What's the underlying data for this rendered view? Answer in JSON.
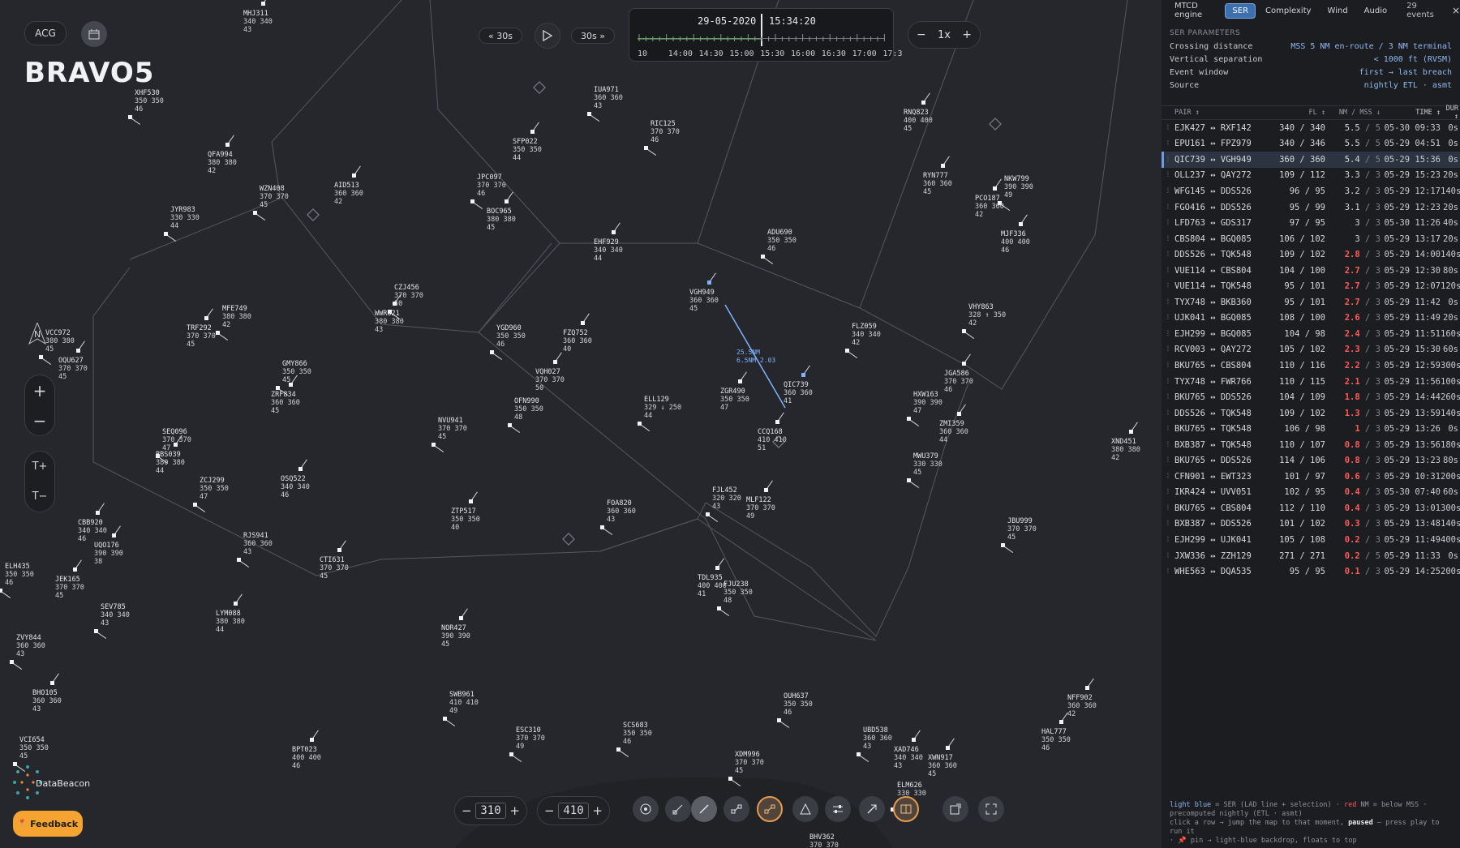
{
  "map": {
    "title": "BRAVO5",
    "acg_label": "ACG",
    "calendar_icon": "calendar-icon",
    "rewind_label": "« 30s",
    "forward_label": "30s »",
    "play_icon": "play-icon",
    "timeline": {
      "date": "29-05-2020",
      "time": "15:34:20",
      "labels": [
        "10",
        "14:00",
        "14:30",
        "15:00",
        "15:30",
        "16:00",
        "16:30",
        "17:00",
        "17:3"
      ]
    },
    "speed": {
      "minus": "−",
      "value": "1x",
      "plus": "+"
    },
    "zoom": {
      "in": "+",
      "out": "−"
    },
    "text_size": {
      "larger": "T+",
      "smaller": "T−"
    },
    "north_label": "N",
    "fl_lower": "310",
    "fl_upper": "410",
    "feedback_label": "Feedback",
    "logo_label": "DataBeacon",
    "sep_line": {
      "label1": "25.5NM",
      "label2": "6.5NM 2.03"
    }
  },
  "aircraft": [
    [
      "MHJ311",
      "340 340",
      "43",
      300,
      12,
      1
    ],
    [
      "XHF530",
      "350 350",
      "46",
      166,
      110,
      0
    ],
    [
      "QFA994",
      "380 380",
      "42",
      256,
      186,
      1
    ],
    [
      "WZN408",
      "370 370",
      "45",
      320,
      228,
      0
    ],
    [
      "AID513",
      "360 360",
      "42",
      412,
      224,
      1
    ],
    [
      "JYR983",
      "330 330",
      "44",
      210,
      254,
      0
    ],
    [
      "SFP022",
      "350 350",
      "44",
      632,
      170,
      1
    ],
    [
      "JPC097",
      "370 370",
      "46",
      588,
      214,
      0
    ],
    [
      "BOC965",
      "380 380",
      "45",
      600,
      256,
      1
    ],
    [
      "IUA971",
      "360 360",
      "43",
      732,
      106,
      0
    ],
    [
      "RIC125",
      "370 370",
      "46",
      802,
      148,
      0
    ],
    [
      "EHF929",
      "340 340",
      "44",
      732,
      294,
      1
    ],
    [
      "RNQ823",
      "400 400",
      "45",
      1114,
      134,
      1
    ],
    [
      "RYN777",
      "360 360",
      "45",
      1138,
      212,
      1
    ],
    [
      "NKW799",
      "390 390",
      "49",
      1238,
      216,
      0
    ],
    [
      "PCO187",
      "360 360",
      "42",
      1202,
      240,
      1
    ],
    [
      "ADU690",
      "350 350",
      "46",
      946,
      282,
      0
    ],
    [
      "MJF336",
      "400 400",
      "46",
      1234,
      284,
      1
    ],
    [
      "CZJ456",
      "370 370",
      "50",
      486,
      350,
      0
    ],
    [
      "WWR621",
      "380 380",
      "43",
      462,
      382,
      1
    ],
    [
      "MFE749",
      "380 380",
      "42",
      274,
      376,
      0
    ],
    [
      "TRF292",
      "370 370",
      "45",
      230,
      400,
      1
    ],
    [
      "YGD960",
      "350 350",
      "46",
      612,
      400,
      0
    ],
    [
      "FZQ752",
      "360 360",
      "40",
      694,
      406,
      1
    ],
    [
      "VGH949",
      "360 360",
      "45",
      850,
      356,
      1
    ],
    [
      "FLZ059",
      "340 340",
      "42",
      1050,
      398,
      0
    ],
    [
      "VHY863",
      "328 ↑ 350",
      "42",
      1194,
      374,
      0
    ],
    [
      "VCC972",
      "380 380",
      "45",
      56,
      406,
      0
    ],
    [
      "OQU627",
      "370 370",
      "45",
      72,
      440,
      1
    ],
    [
      "GMY866",
      "350 350",
      "45",
      348,
      444,
      0
    ],
    [
      "VQH027",
      "370 370",
      "50",
      660,
      454,
      1
    ],
    [
      "OFN990",
      "350 350",
      "48",
      634,
      490,
      0
    ],
    [
      "ELL129",
      "329 ↓ 250",
      "44",
      794,
      488,
      0
    ],
    [
      "ZGR490",
      "350 350",
      "47",
      888,
      478,
      1
    ],
    [
      "QIC739",
      "360 360",
      "41",
      966,
      470,
      1
    ],
    [
      "JGA586",
      "370 370",
      "46",
      1164,
      456,
      1
    ],
    [
      "HXW163",
      "390 390",
      "47",
      1126,
      482,
      0
    ],
    [
      "ZRF834",
      "360 360",
      "45",
      334,
      482,
      1
    ],
    [
      "NVU941",
      "370 370",
      "45",
      540,
      514,
      0
    ],
    [
      "ZMI359",
      "360 360",
      "44",
      1158,
      518,
      1
    ],
    [
      "CCQ168",
      "410 410",
      "51",
      934,
      528,
      1
    ],
    [
      "MWU379",
      "330 330",
      "45",
      1126,
      558,
      0
    ],
    [
      "XND451",
      "380 380",
      "42",
      1370,
      540,
      1
    ],
    [
      "SEQ096",
      "370 370",
      "47",
      200,
      528,
      0
    ],
    [
      "BBS039",
      "380 380",
      "44",
      192,
      556,
      1
    ],
    [
      "ZCJ299",
      "350 350",
      "47",
      246,
      588,
      0
    ],
    [
      "OSQ522",
      "340 340",
      "46",
      346,
      586,
      1
    ],
    [
      "FJL452",
      "320 320",
      "43",
      878,
      600,
      0
    ],
    [
      "MLF122",
      "370 370",
      "49",
      920,
      612,
      1
    ],
    [
      "FOA820",
      "360 360",
      "43",
      748,
      616,
      0
    ],
    [
      "ZTP517",
      "350 350",
      "40",
      556,
      626,
      1
    ],
    [
      "JBU999",
      "370 370",
      "45",
      1242,
      638,
      0
    ],
    [
      "CBB920",
      "340 340",
      "46",
      96,
      640,
      1
    ],
    [
      "UQO176",
      "390 390",
      "38",
      116,
      668,
      1
    ],
    [
      "RJS941",
      "360 360",
      "43",
      300,
      656,
      0
    ],
    [
      "CTI631",
      "370 370",
      "45",
      394,
      686,
      1
    ],
    [
      "ELH435",
      "350 350",
      "46",
      6,
      694,
      0
    ],
    [
      "JEK165",
      "370 370",
      "45",
      68,
      710,
      1
    ],
    [
      "SEV785",
      "340 340",
      "43",
      124,
      744,
      0
    ],
    [
      "LYM088",
      "380 380",
      "44",
      266,
      752,
      1
    ],
    [
      "TDL935",
      "400 400",
      "41",
      860,
      708,
      1
    ],
    [
      "FJU238",
      "350 350",
      "48",
      892,
      716,
      0
    ],
    [
      "NOR427",
      "390 390",
      "45",
      544,
      770,
      1
    ],
    [
      "ZVY844",
      "360 360",
      "43",
      20,
      782,
      0
    ],
    [
      "BHO105",
      "360 360",
      "43",
      40,
      850,
      1
    ],
    [
      "SWB961",
      "410 410",
      "49",
      554,
      852,
      0
    ],
    [
      "OUH637",
      "350 350",
      "46",
      966,
      854,
      0
    ],
    [
      "NFF902",
      "360 360",
      "42",
      1316,
      856,
      1
    ],
    [
      "ESC310",
      "370 370",
      "49",
      636,
      896,
      0
    ],
    [
      "SCS683",
      "350 350",
      "46",
      768,
      890,
      0
    ],
    [
      "HAL777",
      "350 350",
      "46",
      1284,
      898,
      1
    ],
    [
      "UBD538",
      "360 360",
      "43",
      1064,
      896,
      0
    ],
    [
      "XAD746",
      "340 340",
      "43",
      1102,
      920,
      1
    ],
    [
      "XWN917",
      "360 360",
      "45",
      1144,
      930,
      1
    ],
    [
      "XDM996",
      "370 370",
      "45",
      906,
      926,
      0
    ],
    [
      "VCI654",
      "350 350",
      "45",
      24,
      908,
      0
    ],
    [
      "BPT023",
      "400 400",
      "46",
      360,
      920,
      1
    ],
    [
      "ELM626",
      "330 330",
      "43",
      1106,
      964,
      0
    ],
    [
      "BHV362",
      "370 370",
      "",
      998,
      1028,
      0
    ]
  ],
  "panel": {
    "tabs": [
      "MTCD engine",
      "SER",
      "Complexity",
      "Wind",
      "Audio"
    ],
    "active_tab": "SER",
    "events_count": "29 events",
    "close_icon": "×",
    "params_head": "SER PARAMETERS",
    "params": [
      [
        "Crossing distance",
        "MSS 5 NM en-route / 3 NM terminal"
      ],
      [
        "Vertical separation",
        "< 1000 ft (RVSM)"
      ],
      [
        "Event window",
        "first → last breach"
      ],
      [
        "Source",
        "nightly ETL · asmt"
      ]
    ],
    "headers": {
      "pair": "PAIR ↕",
      "fl": "FL ↕",
      "nm": "NM / MSS ↓",
      "time": "TIME ↕",
      "dur": "DUR ↕"
    },
    "rows": [
      [
        "EJK427 ↔ RXF142",
        "340 / 340",
        "5.5",
        "/ 5",
        "05-30 09:33",
        "0s",
        0
      ],
      [
        "EPU161 ↔ FPZ979",
        "340 / 346",
        "5.5",
        "/ 5",
        "05-29 04:51",
        "0s",
        0
      ],
      [
        "QIC739 ↔ VGH949",
        "360 / 360",
        "5.4",
        "/ 5",
        "05-29 15:36",
        "0s",
        0
      ],
      [
        "OLL237 ↔ QAY272",
        "109 / 112",
        "3.3",
        "/ 3",
        "05-29 15:23",
        "20s",
        0
      ],
      [
        "WFG145 ↔ DDS526",
        "96 / 95",
        "3.2",
        "/ 3",
        "05-29 12:17",
        "140s",
        0
      ],
      [
        "FGO416 ↔ DDS526",
        "95 / 99",
        "3.1",
        "/ 3",
        "05-29 12:23",
        "20s",
        0
      ],
      [
        "LFD763 ↔ GDS317",
        "97 / 95",
        "3",
        "/ 3",
        "05-30 11:26",
        "40s",
        0
      ],
      [
        "CBS804 ↔ BGQ085",
        "106 / 102",
        "3",
        "/ 3",
        "05-29 13:17",
        "20s",
        0
      ],
      [
        "DDS526 ↔ TQK548",
        "109 / 102",
        "2.8",
        "/ 3",
        "05-29 14:00",
        "140s",
        1
      ],
      [
        "VUE114 ↔ CBS804",
        "104 / 100",
        "2.7",
        "/ 3",
        "05-29 12:30",
        "80s",
        1
      ],
      [
        "VUE114 ↔ TQK548",
        "95 / 101",
        "2.7",
        "/ 3",
        "05-29 12:07",
        "120s",
        1
      ],
      [
        "TYX748 ↔ BKB360",
        "95 / 101",
        "2.7",
        "/ 3",
        "05-29 11:42",
        "0s",
        1
      ],
      [
        "UJK041 ↔ BGQ085",
        "108 / 100",
        "2.6",
        "/ 3",
        "05-29 11:49",
        "20s",
        1
      ],
      [
        "EJH299 ↔ BGQ085",
        "104 / 98",
        "2.4",
        "/ 3",
        "05-29 11:51",
        "160s",
        1
      ],
      [
        "RCV003 ↔ QAY272",
        "105 / 102",
        "2.3",
        "/ 3",
        "05-29 15:30",
        "60s",
        1
      ],
      [
        "BKU765 ↔ CBS804",
        "110 / 116",
        "2.2",
        "/ 3",
        "05-29 12:59",
        "300s",
        1
      ],
      [
        "TYX748 ↔ FWR766",
        "110 / 115",
        "2.1",
        "/ 3",
        "05-29 11:56",
        "100s",
        1
      ],
      [
        "BKU765 ↔ DDS526",
        "104 / 109",
        "1.8",
        "/ 3",
        "05-29 14:44",
        "260s",
        1
      ],
      [
        "DDS526 ↔ TQK548",
        "109 / 102",
        "1.3",
        "/ 3",
        "05-29 13:59",
        "140s",
        1
      ],
      [
        "BKU765 ↔ TQK548",
        "106 / 98",
        "1",
        "/ 3",
        "05-29 13:26",
        "0s",
        1
      ],
      [
        "BXB387 ↔ TQK548",
        "110 / 107",
        "0.8",
        "/ 3",
        "05-29 13:56",
        "180s",
        1
      ],
      [
        "BKU765 ↔ DDS526",
        "114 / 106",
        "0.8",
        "/ 3",
        "05-29 13:23",
        "80s",
        1
      ],
      [
        "CFN901 ↔ EWT323",
        "101 / 97",
        "0.6",
        "/ 3",
        "05-29 10:31",
        "200s",
        1
      ],
      [
        "IKR424 ↔ UVV051",
        "102 / 95",
        "0.4",
        "/ 3",
        "05-30 07:40",
        "60s",
        1
      ],
      [
        "BKU765 ↔ CBS804",
        "112 / 110",
        "0.4",
        "/ 3",
        "05-29 13:01",
        "300s",
        1
      ],
      [
        "BXB387 ↔ DDS526",
        "101 / 102",
        "0.3",
        "/ 3",
        "05-29 13:48",
        "140s",
        1
      ],
      [
        "EJH299 ↔ UJK041",
        "105 / 108",
        "0.2",
        "/ 3",
        "05-29 11:49",
        "400s",
        1
      ],
      [
        "JXW336 ↔ ZZH129",
        "271 / 271",
        "0.2",
        "/ 5",
        "05-29 11:33",
        "0s",
        1
      ],
      [
        "WHE563 ↔ DQA535",
        "95 / 95",
        "0.1",
        "/ 3",
        "05-29 14:25",
        "200s",
        1
      ]
    ],
    "selected_row": 2,
    "legend": {
      "l1a": "light blue",
      "l1b": " = SER (LAD line + selection) · ",
      "l1c": "red",
      "l1d": " NM = below MSS ·",
      "l2": "precomputed nightly (ETL · asmt)",
      "l3a": "click a row → jump the map to that moment, ",
      "l3b": "paused",
      "l3c": " — press play to run it",
      "l4": "· 📌 pin → light-blue backdrop, floats to top"
    },
    "colors": {
      "accent": "#3b6fae",
      "breach": "#ff5a55",
      "ser": "#8fb8f0"
    }
  }
}
